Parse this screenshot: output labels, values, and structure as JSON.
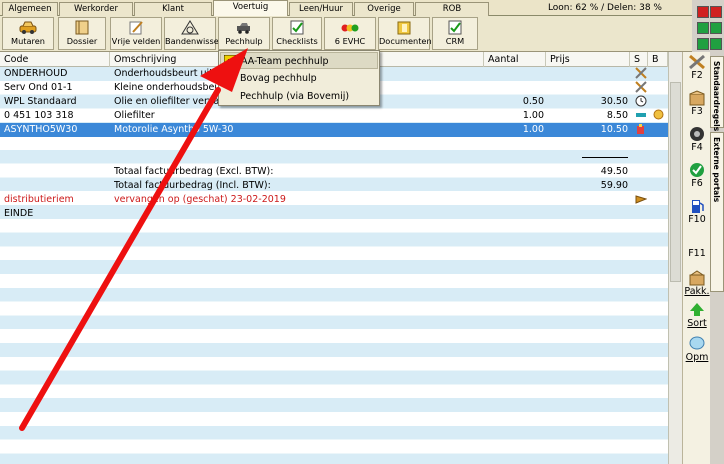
{
  "tabs": [
    {
      "label": "Algemeen"
    },
    {
      "label": "Werkorder"
    },
    {
      "label": "Klant"
    },
    {
      "label": "Voertuig"
    },
    {
      "label": "Leen/Huur"
    },
    {
      "label": "Overige"
    },
    {
      "label": "ROB"
    }
  ],
  "status": "Loon: 62 % / Delen: 38 %",
  "toolbar": [
    {
      "label": "Mutaren",
      "icon": "car-icon"
    },
    {
      "label": "Dossier",
      "icon": "book-icon"
    },
    {
      "label": "Vrije velden",
      "icon": "pencil-icon"
    },
    {
      "label": "Bandenwissel",
      "icon": "tire-icon"
    },
    {
      "label": "Pechhulp",
      "icon": "tow-truck-icon"
    },
    {
      "label": "Checklists",
      "icon": "checklist-icon"
    },
    {
      "label": "6 EVHC",
      "icon": "traffic-light-icon"
    },
    {
      "label": "Documenten",
      "icon": "folder-icon"
    },
    {
      "label": "CRM",
      "icon": "crm-icon"
    }
  ],
  "columns": {
    "code": "Code",
    "desc": "Omschrijving",
    "amount": "Aantal",
    "price": "Prijs",
    "s": "S",
    "b": "B"
  },
  "rows": [
    {
      "code": "ONDERHOUD",
      "desc": "Onderhoudsbeurt uitvoe",
      "amount": "",
      "price": "",
      "icon": "wrench-icon"
    },
    {
      "code": "Serv Ond 01-1",
      "desc": "Kleine onderhoudsbeurt",
      "amount": "",
      "price": "",
      "icon": "wrench-icon"
    },
    {
      "code": "WPL Standaard",
      "desc": "Olie en oliefilter vervang",
      "amount": "0.50",
      "price": "30.50",
      "icon": "clock-icon"
    },
    {
      "code": "0 451 103 318",
      "desc": "Oliefilter",
      "amount": "1.00",
      "price": "8.50",
      "icon": "part-icon"
    },
    {
      "code": "ASYNTHO5W30",
      "desc": "Motorolie Asyntho 5W-30",
      "amount": "1.00",
      "price": "10.50",
      "icon": "oil-icon"
    }
  ],
  "totals": [
    {
      "label": "Totaal factuurbedrag (Excl. BTW):",
      "value": "49.50"
    },
    {
      "label": "Totaal factuurbedrag (Incl. BTW):",
      "value": "59.90"
    }
  ],
  "note": {
    "code": "distributieriem",
    "desc": "vervangen op (geschat) 23-02-2019"
  },
  "end": {
    "code": "EINDE"
  },
  "dropdown": [
    {
      "label": "AA-Team pechhulp",
      "icon": "aa-logo-icon"
    },
    {
      "label": "Bovag pechhulp",
      "icon": "bovag-logo-icon"
    },
    {
      "label": "Pechhulp (via Bovemij)",
      "icon": ""
    }
  ],
  "side": [
    {
      "label": "F2",
      "icon": "wrench-icon"
    },
    {
      "label": "F3",
      "icon": "box-icon"
    },
    {
      "label": "F4",
      "icon": "tire-icon"
    },
    {
      "label": "F6",
      "icon": "crm-icon"
    },
    {
      "label": "F10",
      "icon": "fuel-icon"
    },
    {
      "label": "F11",
      "icon": ""
    },
    {
      "label": "Pakk.",
      "icon": "package-icon"
    },
    {
      "label": "Sort",
      "icon": "sort-icon"
    },
    {
      "label": "Opm",
      "icon": "note-icon"
    }
  ],
  "vtabs": [
    {
      "label": "Standaardregels"
    },
    {
      "label": "Externe portals"
    }
  ],
  "colors": {
    "selected_row": "#3b88d8",
    "stripe": "#d8ecf6",
    "arrow": "#ee1010",
    "note_text": "#cc1a1a"
  }
}
